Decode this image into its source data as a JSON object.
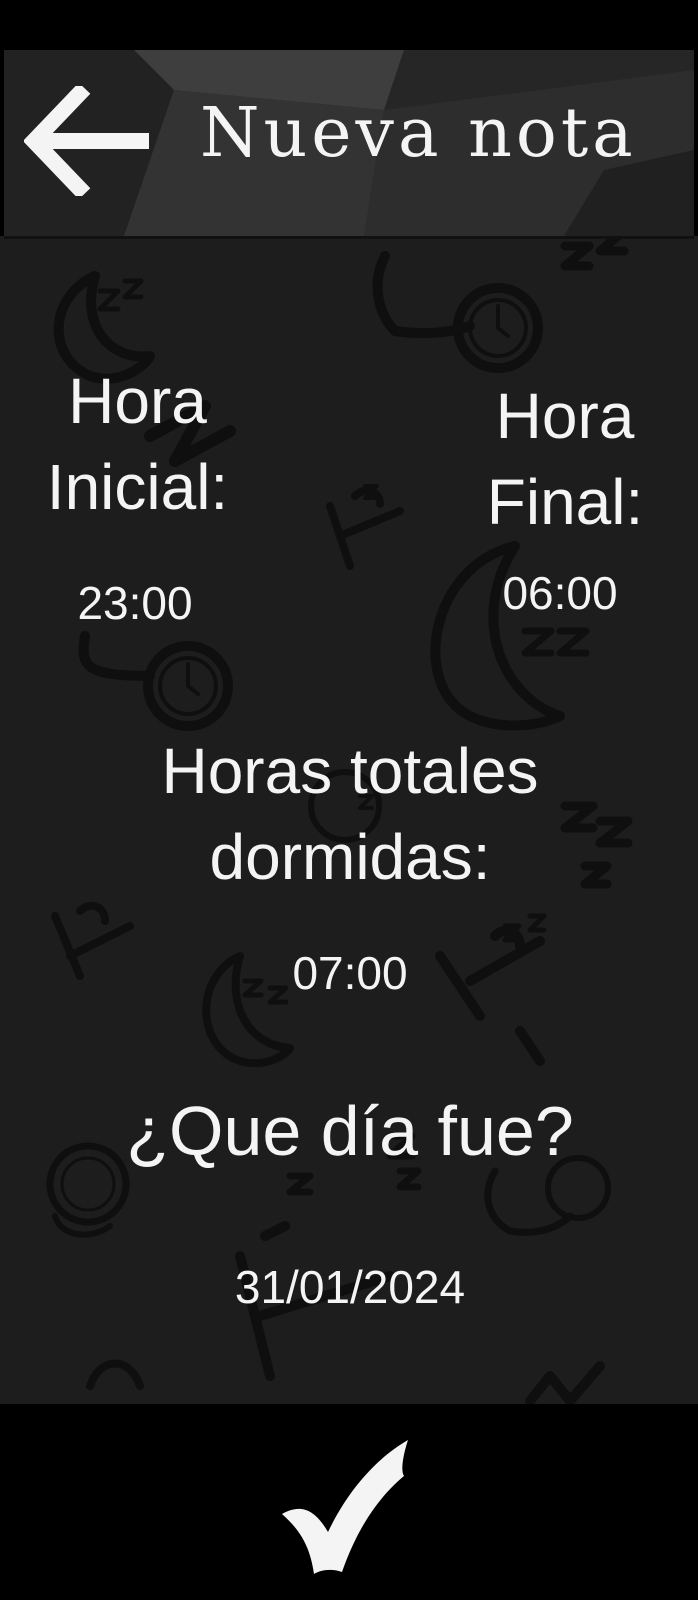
{
  "header": {
    "back_icon": "arrow-left-icon",
    "title": "Nueva nota"
  },
  "sleep": {
    "start_label_line1": "Hora",
    "start_label_line2": "Inicial:",
    "start_value": "23:00",
    "end_label_line1": "Hora",
    "end_label_line2": "Final:",
    "end_value": "06:00",
    "total_label_line1": "Horas totales",
    "total_label_line2": "dormidas:",
    "total_value": "07:00"
  },
  "day": {
    "question": "¿Que día fue?",
    "date_value": "31/01/2024"
  },
  "footer": {
    "confirm_icon": "checkmark-icon"
  },
  "colors": {
    "background": "#1d1d1d",
    "header": "#2a2a2a",
    "bars": "#000000",
    "text": "#f4f4f4"
  }
}
